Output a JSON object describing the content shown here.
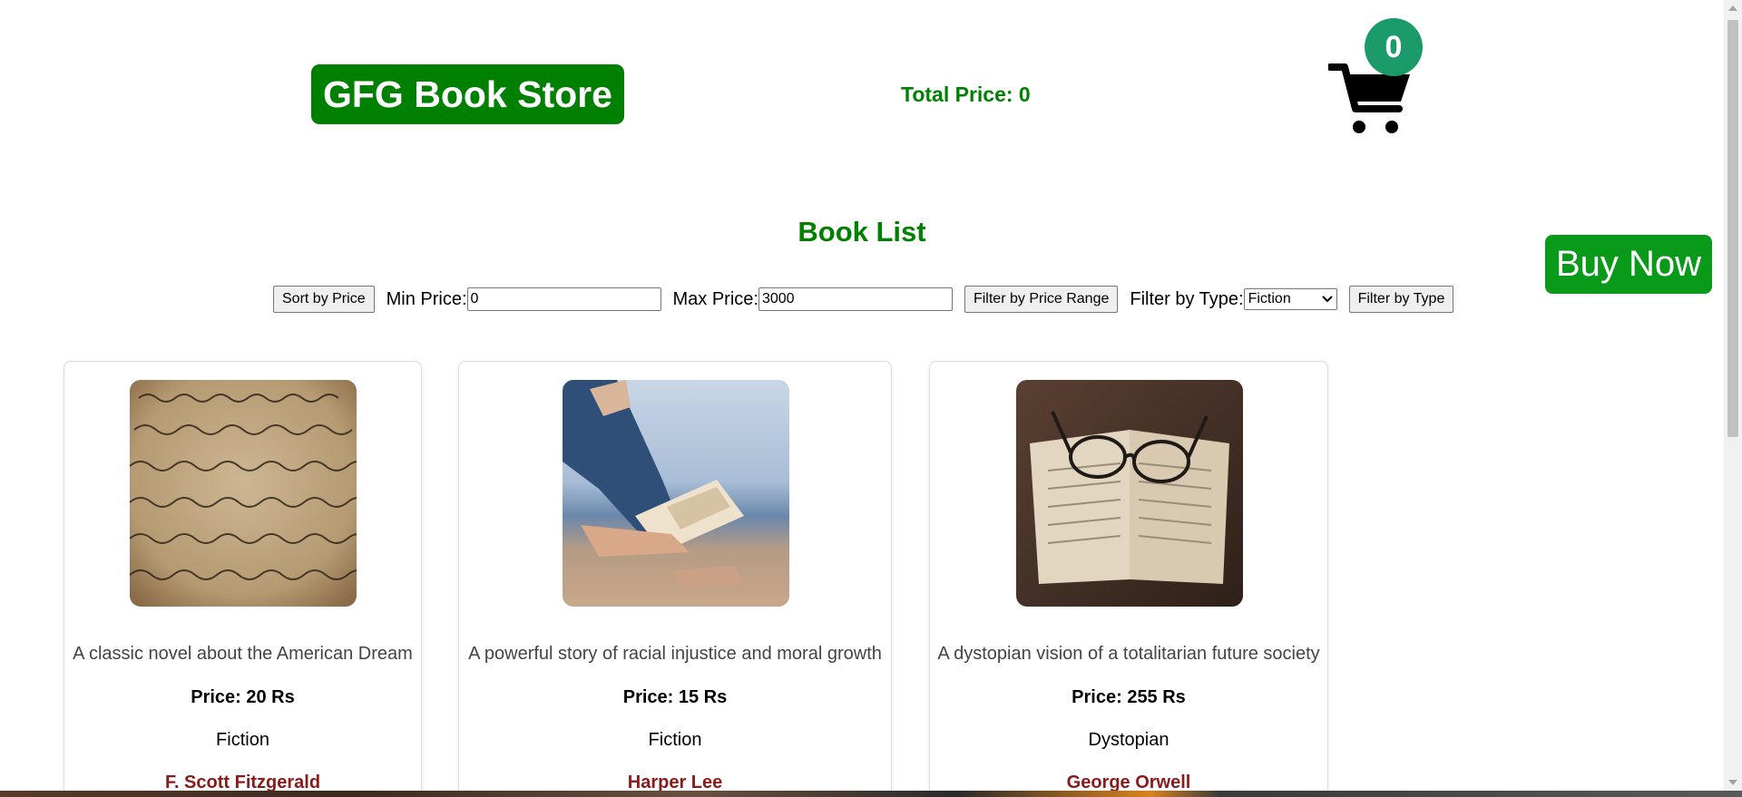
{
  "header": {
    "logo_text": "GFG Book Store",
    "total_price_text": "Total Price: 0",
    "cart_count": "0",
    "cart_icon": "shopping-cart-icon"
  },
  "buy_now_label": "Buy Now",
  "section_title": "Book List",
  "controls": {
    "sort_by_price_label": "Sort by Price",
    "min_price_label": "Min Price:",
    "min_price_value": "0",
    "max_price_label": "Max Price:",
    "max_price_value": "3000",
    "filter_price_range_label": "Filter by Price Range",
    "filter_by_type_label": "Filter by Type:",
    "type_selected": "Fiction",
    "filter_by_type_button": "Filter by Type"
  },
  "books": [
    {
      "image": "handwritten-letter-image",
      "description": "A classic novel about the American Dream",
      "price": "Price: 20 Rs",
      "type": "Fiction",
      "author": "F. Scott Fitzgerald"
    },
    {
      "image": "woman-reading-by-sea-image",
      "description": "A powerful story of racial injustice and moral growth",
      "price": "Price: 15 Rs",
      "type": "Fiction",
      "author": "Harper Lee"
    },
    {
      "image": "open-book-with-glasses-image",
      "description": "A dystopian vision of a totalitarian future society",
      "price": "Price: 255 Rs",
      "type": "Dystopian",
      "author": "George Orwell"
    }
  ],
  "colors": {
    "brand_green": "#008000",
    "badge_green": "#1c9b6a",
    "buy_now_green": "#0a9a1a",
    "author_red": "#8b1a1a"
  }
}
